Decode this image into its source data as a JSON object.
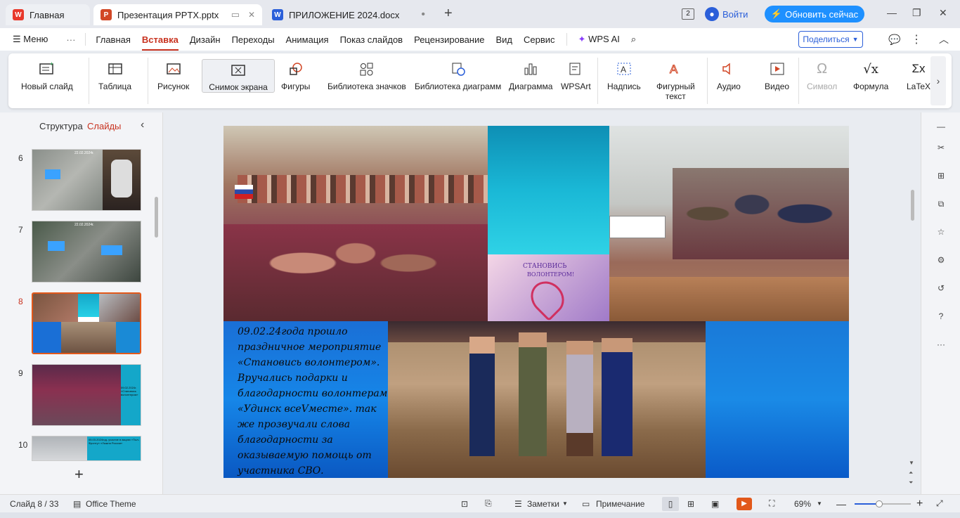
{
  "tabs": [
    {
      "label": "Главная",
      "icon": "wps-logo-icon"
    },
    {
      "label": "Презентация PPTX.pptx",
      "icon": "presentation-icon"
    },
    {
      "label": "ПРИЛОЖЕНИЕ 2024.docx",
      "icon": "word-icon"
    }
  ],
  "titlebar": {
    "badge": "2",
    "login": "Войти",
    "update": "Обновить сейчас"
  },
  "menu": {
    "menu_label": "Меню",
    "items": [
      "Главная",
      "Вставка",
      "Дизайн",
      "Переходы",
      "Анимация",
      "Показ слайдов",
      "Рецензирование",
      "Вид",
      "Сервис"
    ],
    "active": "Вставка",
    "wps_ai": "WPS AI",
    "share": "Поделиться"
  },
  "ribbon": {
    "new_slide": "Новый слайд",
    "table": "Таблица",
    "picture": "Рисунок",
    "screenshot": "Снимок экрана",
    "shapes": "Фигуры",
    "icon_library": "Библиотека значков",
    "chart_library": "Библиотека диаграмм",
    "chart": "Диаграмма",
    "wpsart": "WPSArt",
    "textbox": "Надпись",
    "wordart_1": "Фигурный",
    "wordart_2": "текст",
    "audio": "Аудио",
    "video": "Видео",
    "symbol": "Символ",
    "formula": "Формула",
    "latex": "LaTeX"
  },
  "panel": {
    "structure": "Структура",
    "slides": "Слайды"
  },
  "thumbs": [
    {
      "num": "6",
      "caption": "22.02.2024г."
    },
    {
      "num": "7",
      "caption": "22.02.2024г."
    },
    {
      "num": "8",
      "caption": ""
    },
    {
      "num": "9",
      "caption": "09.02.2024г. «Становись волонтером»"
    },
    {
      "num": "10",
      "caption": "05.03.2024год- участие в акциях «Тыл-Фронту» «Лыжня России»"
    }
  ],
  "slide": {
    "text": "09.02.24года прошло праздничное мероприятие «Становись волонтером». Вручались подарки и благодарности  волонтерам «Удинск всеVместе». так же прозвучали слова благодарности за оказываемую помощь от  участника СВО.",
    "banner_line1": "СТАНОВИСЬ",
    "banner_line2": "ВОЛОНТЕРОМ!"
  },
  "status": {
    "slide_info": "Слайд 8 / 33",
    "theme": "Office Theme",
    "notes": "Заметки",
    "comment": "Примечание",
    "zoom": "69%"
  },
  "colors": {
    "accent": "#c8321f",
    "update_btn": "#1e90ff",
    "slide_blue": "#1a6fd6",
    "teal": "#14b8d6"
  }
}
